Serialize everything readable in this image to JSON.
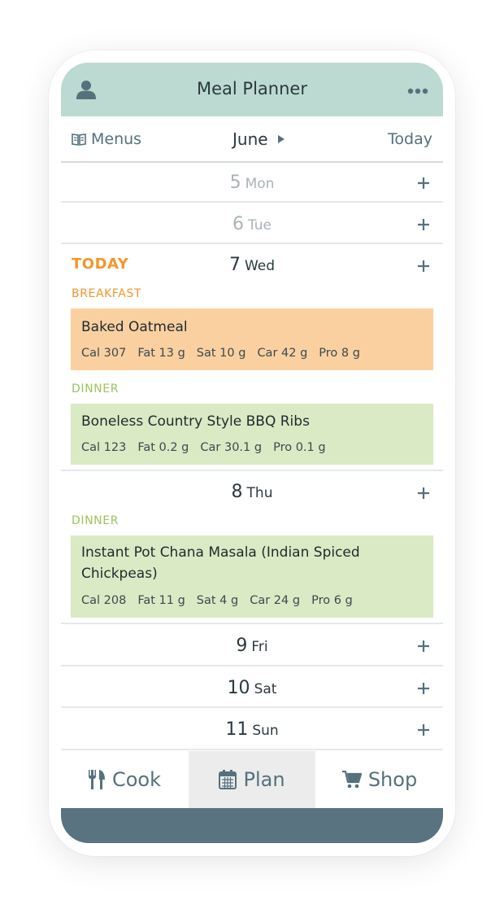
{
  "app": {
    "title": "Meal Planner"
  },
  "icons": {
    "profile": "user-icon",
    "more": "more-dots-icon",
    "menus": "book-icon",
    "month_next": "caret-right-icon",
    "add": "plus-icon",
    "cook": "fork-knife-icon",
    "plan": "calendar-icon",
    "shop": "cart-icon"
  },
  "colors": {
    "header_bg": "#bcd9d2",
    "breakfast_card": "#fbd0a1",
    "breakfast_label": "#f3962b",
    "dinner_card": "#daeac4",
    "dinner_label": "#9bc45a",
    "today_accent": "#f3962b",
    "bottom_bar": "#5a7380",
    "icon_gray": "#55717c"
  },
  "subbar": {
    "menus_label": "Menus",
    "month": "June",
    "today_label": "Today"
  },
  "days": [
    {
      "num": "5",
      "name": "Mon"
    },
    {
      "num": "6",
      "name": "Tue"
    },
    {
      "num": "7",
      "name": "Wed",
      "tag": "TODAY"
    },
    {
      "num": "8",
      "name": "Thu"
    },
    {
      "num": "9",
      "name": "Fri"
    },
    {
      "num": "10",
      "name": "Sat"
    },
    {
      "num": "11",
      "name": "Sun"
    }
  ],
  "meals": {
    "wed_breakfast": {
      "label": "BREAKFAST",
      "name": "Baked Oatmeal",
      "nutrition": [
        "Cal 307",
        "Fat 13 g",
        "Sat 10 g",
        "Car 42 g",
        "Pro 8 g"
      ]
    },
    "wed_dinner": {
      "label": "DINNER",
      "name": "Boneless Country Style BBQ Ribs",
      "nutrition": [
        "Cal 123",
        "Fat 0.2 g",
        "Car 30.1 g",
        "Pro 0.1 g"
      ]
    },
    "thu_dinner": {
      "label": "DINNER",
      "name_line1": "Instant Pot Chana Masala (Indian Spiced",
      "name_line2": "Chickpeas)",
      "nutrition": [
        "Cal 208",
        "Fat 11 g",
        "Sat 4 g",
        "Car 24 g",
        "Pro 6 g"
      ]
    }
  },
  "tabs": [
    {
      "label": "Cook"
    },
    {
      "label": "Plan",
      "active": true
    },
    {
      "label": "Shop"
    }
  ]
}
